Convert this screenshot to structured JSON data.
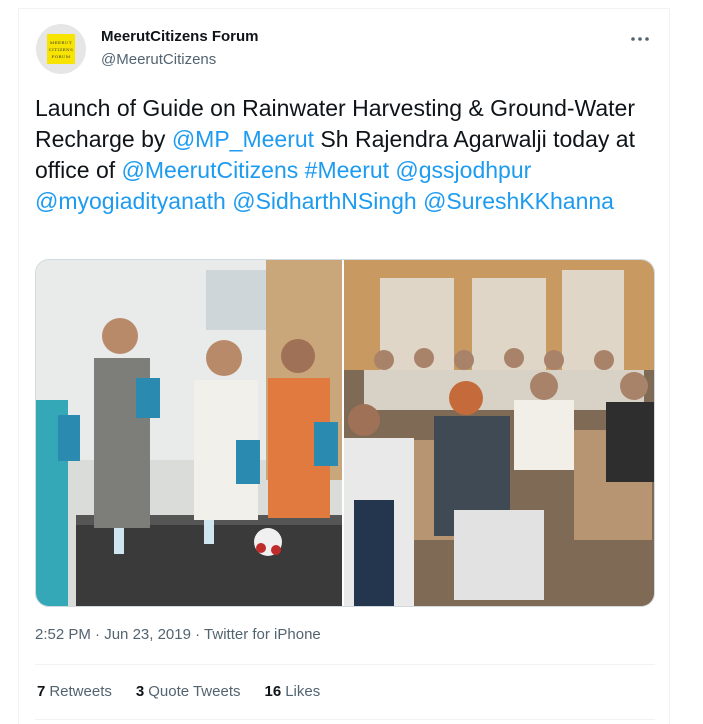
{
  "account": {
    "display_name": "MeerutCitizens Forum",
    "handle": "@MeerutCitizens",
    "avatar_lines": [
      "MEERUT",
      "CITIZENS",
      "FORUM"
    ]
  },
  "more_icon": "more-horizontal-icon",
  "tweet": {
    "text_1": "Launch of Guide on Rainwater Harvesting & Ground-Water Recharge by ",
    "mention_1": "@MP_Meerut",
    "text_2": " Sh Rajendra Agarwalji today at office of ",
    "mention_2": "@MeerutCitizens",
    "hashtag_1": "#Meerut",
    "mention_3": "@gssjodhpur",
    "mention_4": "@myogiadityanath",
    "mention_5": "@SidharthNSingh",
    "mention_6": "@SureshKKhanna"
  },
  "meta": {
    "time": "2:52 PM",
    "sep1": " · ",
    "date": "Jun 23, 2019",
    "sep2": " · ",
    "source": "Twitter for iPhone"
  },
  "stats": {
    "retweets_count": "7",
    "retweets_label": "Retweets",
    "quotes_count": "3",
    "quotes_label": "Quote Tweets",
    "likes_count": "16",
    "likes_label": "Likes"
  },
  "colors": {
    "link": "#1d9bf0",
    "text": "#0f1419",
    "secondary": "#536471",
    "avatar_badge": "#f7e400"
  }
}
